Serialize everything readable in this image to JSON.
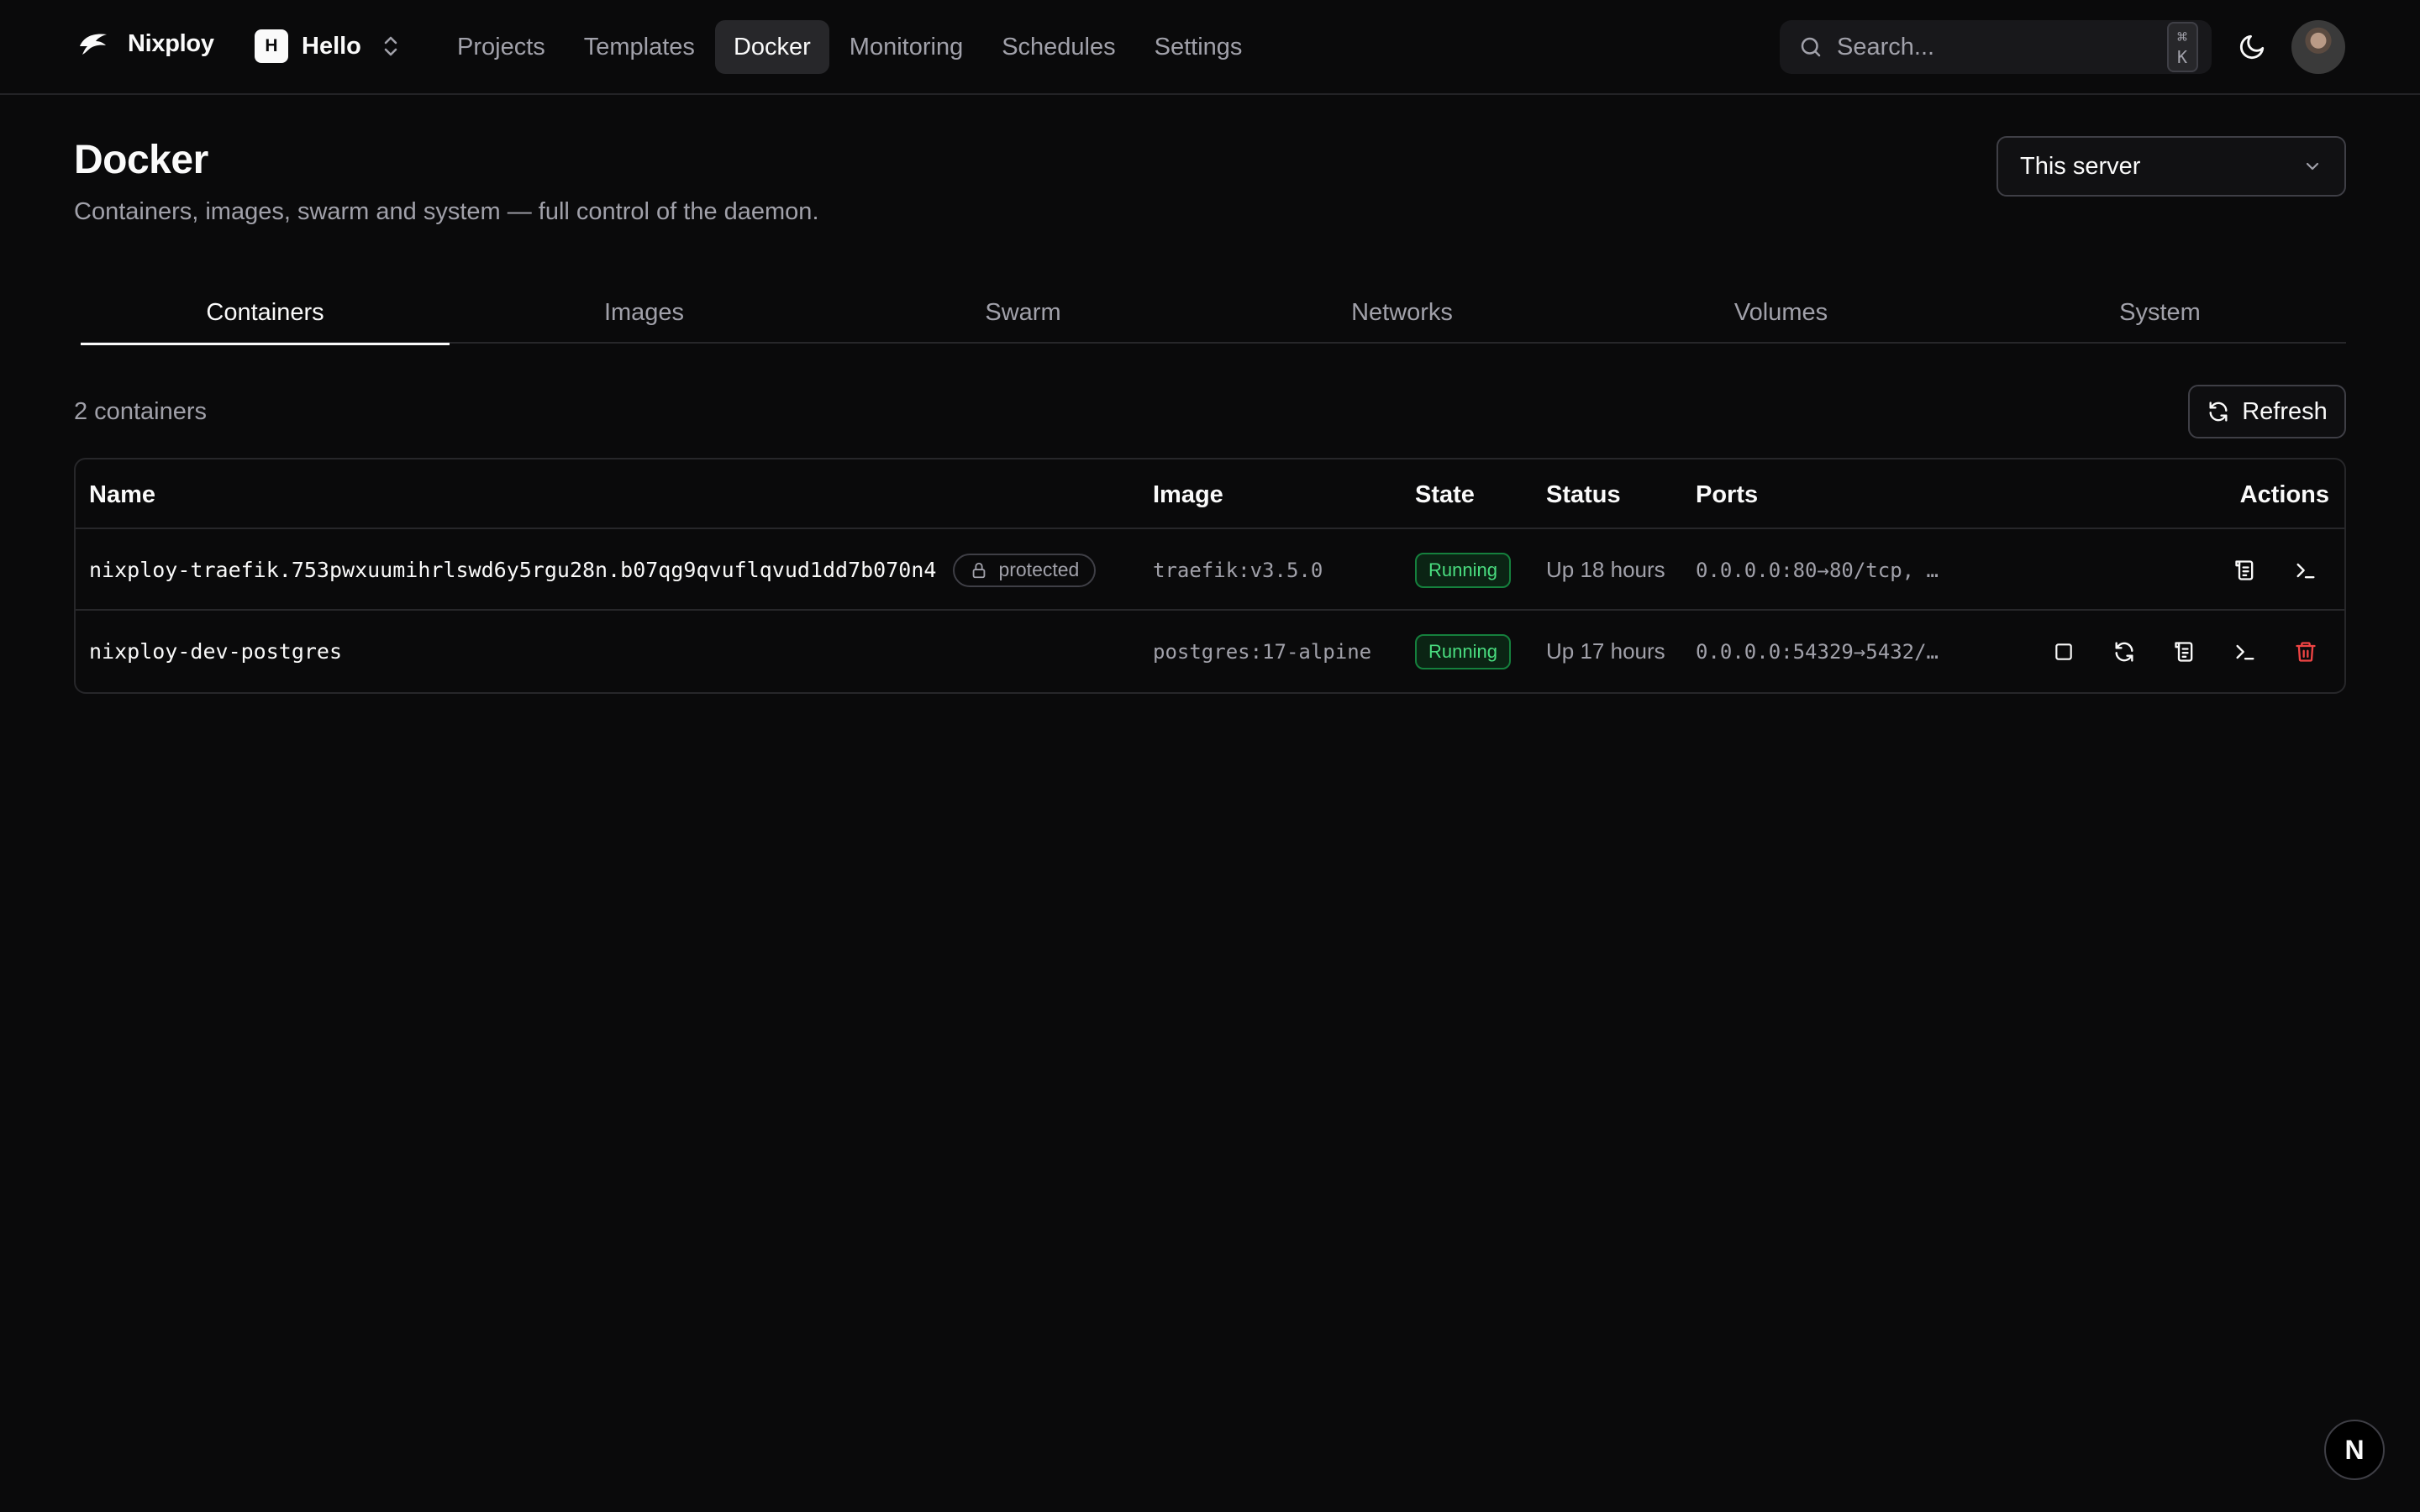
{
  "app": {
    "brand": "Nixploy",
    "team": {
      "initial": "H",
      "name": "Hello"
    }
  },
  "nav": {
    "links": [
      {
        "label": "Projects",
        "active": false
      },
      {
        "label": "Templates",
        "active": false
      },
      {
        "label": "Docker",
        "active": true
      },
      {
        "label": "Monitoring",
        "active": false
      },
      {
        "label": "Schedules",
        "active": false
      },
      {
        "label": "Settings",
        "active": false
      }
    ],
    "search_placeholder": "Search...",
    "search_shortcut": "⌘ K"
  },
  "page": {
    "title": "Docker",
    "subtitle": "Containers, images, swarm and system — full control of the daemon.",
    "server_select": "This server"
  },
  "tabs": [
    {
      "label": "Containers",
      "active": true
    },
    {
      "label": "Images",
      "active": false
    },
    {
      "label": "Swarm",
      "active": false
    },
    {
      "label": "Networks",
      "active": false
    },
    {
      "label": "Volumes",
      "active": false
    },
    {
      "label": "System",
      "active": false
    }
  ],
  "toolbar": {
    "count_label": "2 containers",
    "refresh_label": "Refresh"
  },
  "table": {
    "columns": [
      "Name",
      "Image",
      "State",
      "Status",
      "Ports",
      "Actions"
    ],
    "rows": [
      {
        "name": "nixploy-traefik.753pwxuumihrlswd6y5rgu28n.b07qg9qvuflqvud1dd7b070n4",
        "protected_label": "protected",
        "image": "traefik:v3.5.0",
        "state": "Running",
        "status": "Up 18 hours",
        "ports": "0.0.0.0:80→80/tcp, …",
        "actions": [
          "logs",
          "terminal"
        ]
      },
      {
        "name": "nixploy-dev-postgres",
        "image": "postgres:17-alpine",
        "state": "Running",
        "status": "Up 17 hours",
        "ports": "0.0.0.0:54329→5432/…",
        "actions": [
          "stop",
          "restart",
          "logs",
          "terminal",
          "delete"
        ]
      }
    ]
  },
  "colors": {
    "background": "#0a0a0b",
    "running_text": "#4ade80",
    "running_border": "#15803d",
    "danger": "#ef4444"
  },
  "dev_badge": "N"
}
